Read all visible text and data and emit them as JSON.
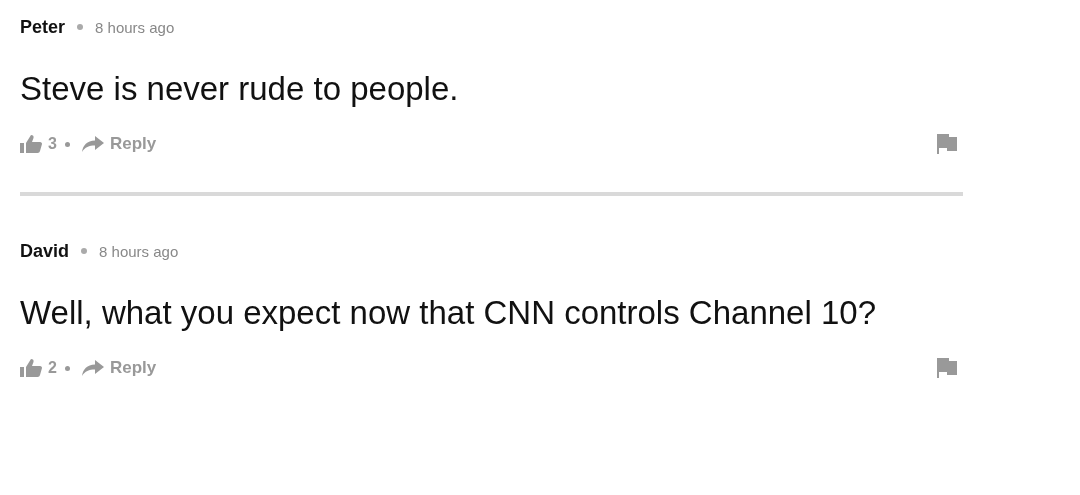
{
  "comments": [
    {
      "author": "Peter",
      "time": "8 hours ago",
      "text": "Steve is never rude to people.",
      "likes": "3",
      "reply": "Reply"
    },
    {
      "author": "David",
      "time": "8 hours ago",
      "text": "Well, what you expect now that CNN controls Channel 10?",
      "likes": "2",
      "reply": "Reply"
    }
  ]
}
